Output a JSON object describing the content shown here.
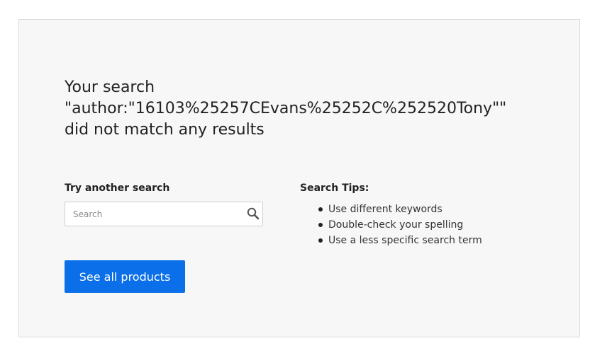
{
  "result": {
    "heading_line1": "Your search",
    "heading_line2": "\"author:\"16103%25257CEvans%25252C%252520Tony\"\"",
    "heading_line3": "did not match any results"
  },
  "search": {
    "label": "Try another search",
    "placeholder": "Search",
    "value": "",
    "icon": "search-icon"
  },
  "tips": {
    "label": "Search Tips:",
    "items": [
      "Use different keywords",
      "Double-check your spelling",
      "Use a less specific search term"
    ]
  },
  "cta": {
    "label": "See all products"
  },
  "colors": {
    "panel_bg": "#f7f7f8",
    "accent": "#0a6fe8",
    "text": "#222222"
  }
}
